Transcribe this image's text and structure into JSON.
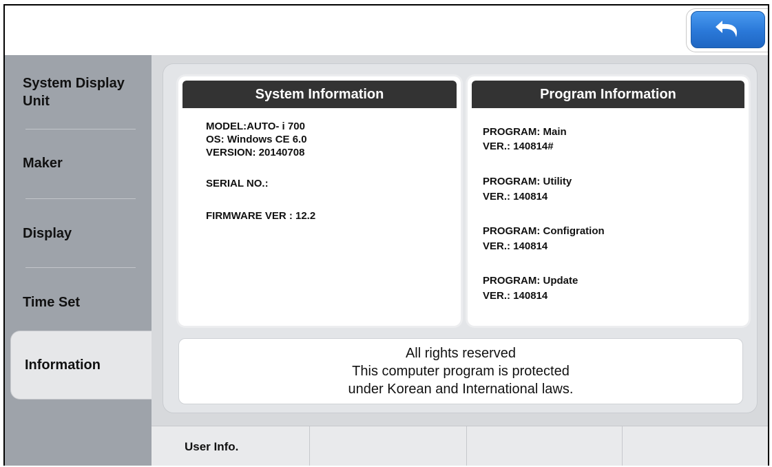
{
  "toolbar": {
    "back_icon": "back-arrow-icon"
  },
  "sidebar": {
    "items": [
      {
        "label_line1": "System Display",
        "label_line2": "Unit"
      },
      {
        "label": "Maker"
      },
      {
        "label": "Display"
      },
      {
        "label": "Time Set"
      },
      {
        "label": "Information",
        "active": true
      }
    ]
  },
  "system_info": {
    "title": "System Information",
    "lines": [
      "MODEL:AUTO- i 700",
      "OS: Windows CE 6.0",
      "VERSION: 20140708",
      "SERIAL NO.:",
      "FIRMWARE VER : 12.2"
    ]
  },
  "program_info": {
    "title": "Program Information",
    "programs": [
      {
        "name": "PROGRAM: Main",
        "version": "VER.: 140814#"
      },
      {
        "name": "PROGRAM: Utility",
        "version": "VER.: 140814"
      },
      {
        "name": "PROGRAM: Configration",
        "version": "VER.: 140814"
      },
      {
        "name": "PROGRAM: Update",
        "version": "VER.: 140814"
      }
    ]
  },
  "copyright": {
    "line1": "All rights reserved",
    "line2": "This computer program is protected",
    "line3": "under Korean and International laws."
  },
  "bottom_tabs": [
    {
      "label": "User Info."
    },
    {
      "label": ""
    },
    {
      "label": ""
    },
    {
      "label": ""
    }
  ],
  "colors": {
    "sidebar_bg": "#9ea3aa",
    "header_dark": "#333333",
    "back_button_blue": "#2a78d8"
  }
}
